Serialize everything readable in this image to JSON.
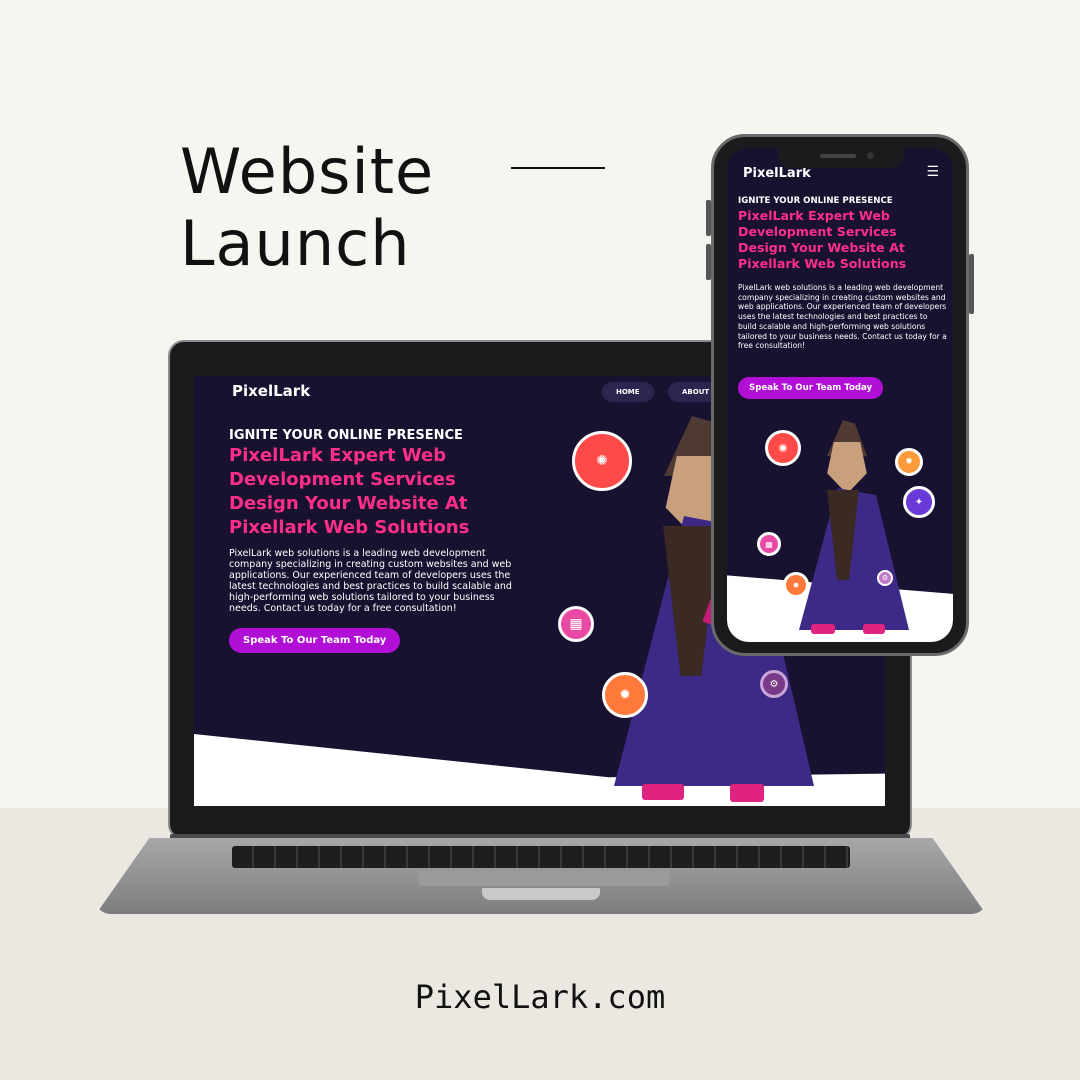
{
  "headline": {
    "line1": "Website",
    "line2": "Launch"
  },
  "domain": "PixelLark.com",
  "laptop_site": {
    "logo": "PixelLark",
    "nav": [
      {
        "label": "HOME"
      },
      {
        "label": "ABOUT"
      }
    ],
    "eyebrow": "IGNITE YOUR ONLINE PRESENCE",
    "title": "PixelLark Expert Web Development Services Design Your Website At Pixellark Web Solutions",
    "body": "PixelLark web solutions is a leading web development company specializing in creating custom websites and web applications. Our experienced team of developers uses the latest technologies and best practices to build scalable and high-performing web solutions tailored to your business needs. Contact us today for a free consultation!",
    "cta": "Speak To Our Team Today"
  },
  "phone_site": {
    "logo": "PixelLark",
    "menu_icon": "hamburger-menu-icon",
    "eyebrow": "IGNITE YOUR ONLINE PRESENCE",
    "title": "PixelLark Expert Web Development Services Design Your Website At Pixellark Web Solutions",
    "body": "PixelLark web solutions is a leading web development company specializing in creating custom websites and web applications. Our experienced team of developers uses the latest technologies and best practices to build scalable and high-performing web solutions tailored to your business needs. Contact us today for a free consultation!",
    "cta": "Speak To Our Team Today"
  },
  "colors": {
    "accent_pink": "#ff2e8a",
    "cta_purple": "#b20fd6",
    "site_bg": "#181230"
  }
}
